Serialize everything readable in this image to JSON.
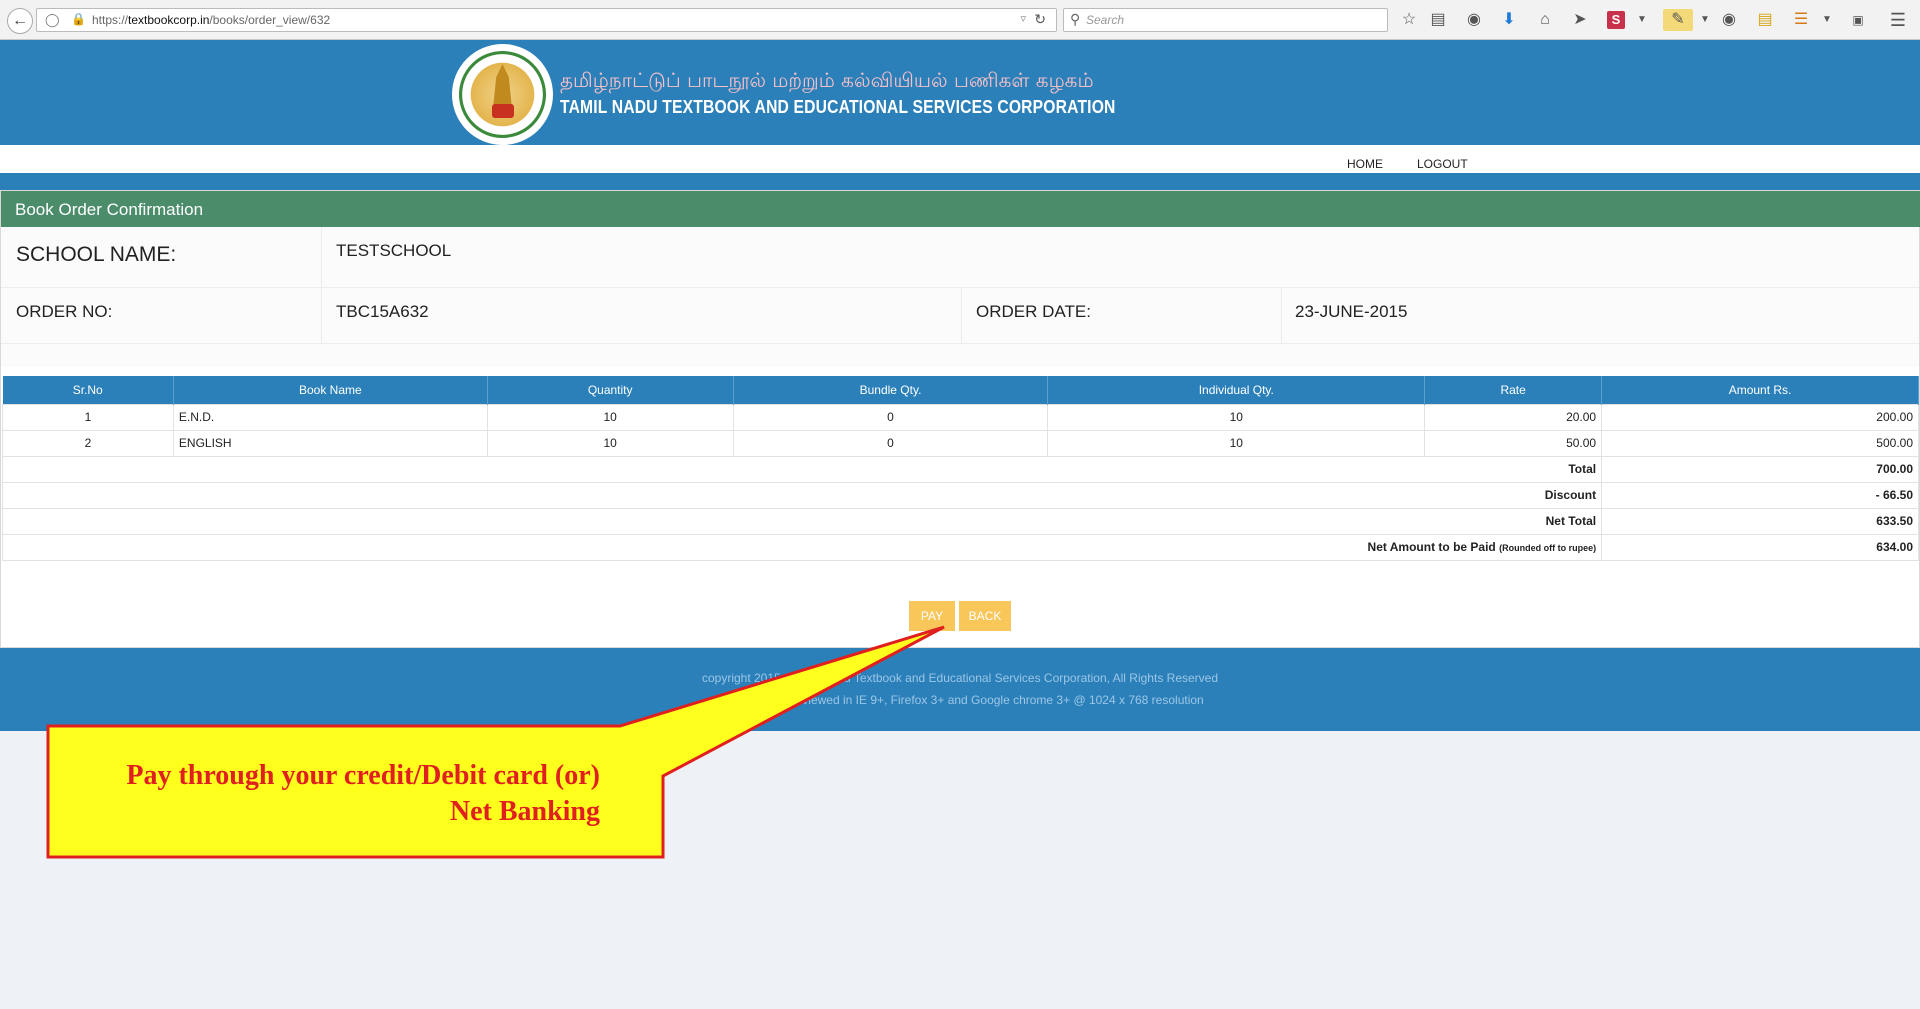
{
  "browser": {
    "url_prefix": "https://",
    "url_domain": "textbookcorp.in",
    "url_path": "/books/order_view/632",
    "search_placeholder": "Search",
    "toolbar_icons": [
      "star-icon",
      "reading-list-icon",
      "pocket-icon",
      "download-icon",
      "home-icon",
      "send-icon",
      "s-extension-icon",
      "pencil-extension-icon",
      "chat-icon",
      "notes-icon",
      "translate-icon",
      "k-extension-icon",
      "menu-icon"
    ]
  },
  "site": {
    "title_tamil": "தமிழ்நாட்டுப் பாடநூல் மற்றும் கல்வியியல் பணிகள் கழகம்",
    "title_en": "TAMIL NADU TEXTBOOK AND EDUCATIONAL SERVICES CORPORATION"
  },
  "nav": {
    "home": "HOME",
    "logout": "LOGOUT"
  },
  "panel": {
    "title": "Book Order Confirmation",
    "school_label": "SCHOOL NAME:",
    "school_value": "TESTSCHOOL",
    "order_no_label": "ORDER NO:",
    "order_no_value": "TBC15A632",
    "order_date_label": "ORDER DATE:",
    "order_date_value": "23-JUNE-2015"
  },
  "table": {
    "headers": [
      "Sr.No",
      "Book Name",
      "Quantity",
      "Bundle Qty.",
      "Individual Qty.",
      "Rate",
      "Amount Rs."
    ],
    "rows": [
      [
        "1",
        "E.N.D.",
        "10",
        "0",
        "10",
        "20.00",
        "200.00"
      ],
      [
        "2",
        "ENGLISH",
        "10",
        "0",
        "10",
        "50.00",
        "500.00"
      ]
    ],
    "total_label": "Total",
    "total_value": "700.00",
    "discount_label": "Discount",
    "discount_value": "- 66.50",
    "net_total_label": "Net Total",
    "net_total_value": "633.50",
    "net_amount_label": "Net Amount to be Paid",
    "net_amount_note": "(Rounded off to rupee)",
    "net_amount_value": "634.00"
  },
  "buttons": {
    "pay": "PAY",
    "back": "BACK"
  },
  "footer": {
    "line1": "copyright 2015 © Tamilnadu Textbook and Educational Services Corporation, All Rights Reserved",
    "line2": "This site is best viewed in IE 9+, Firefox 3+ and Google chrome 3+ @ 1024 x 768 resolution"
  },
  "callout": {
    "line1": "Pay through your credit/Debit card (or)",
    "line2": "Net Banking",
    "fill_color": "#ffff1e",
    "border_color": "#e0201e"
  }
}
